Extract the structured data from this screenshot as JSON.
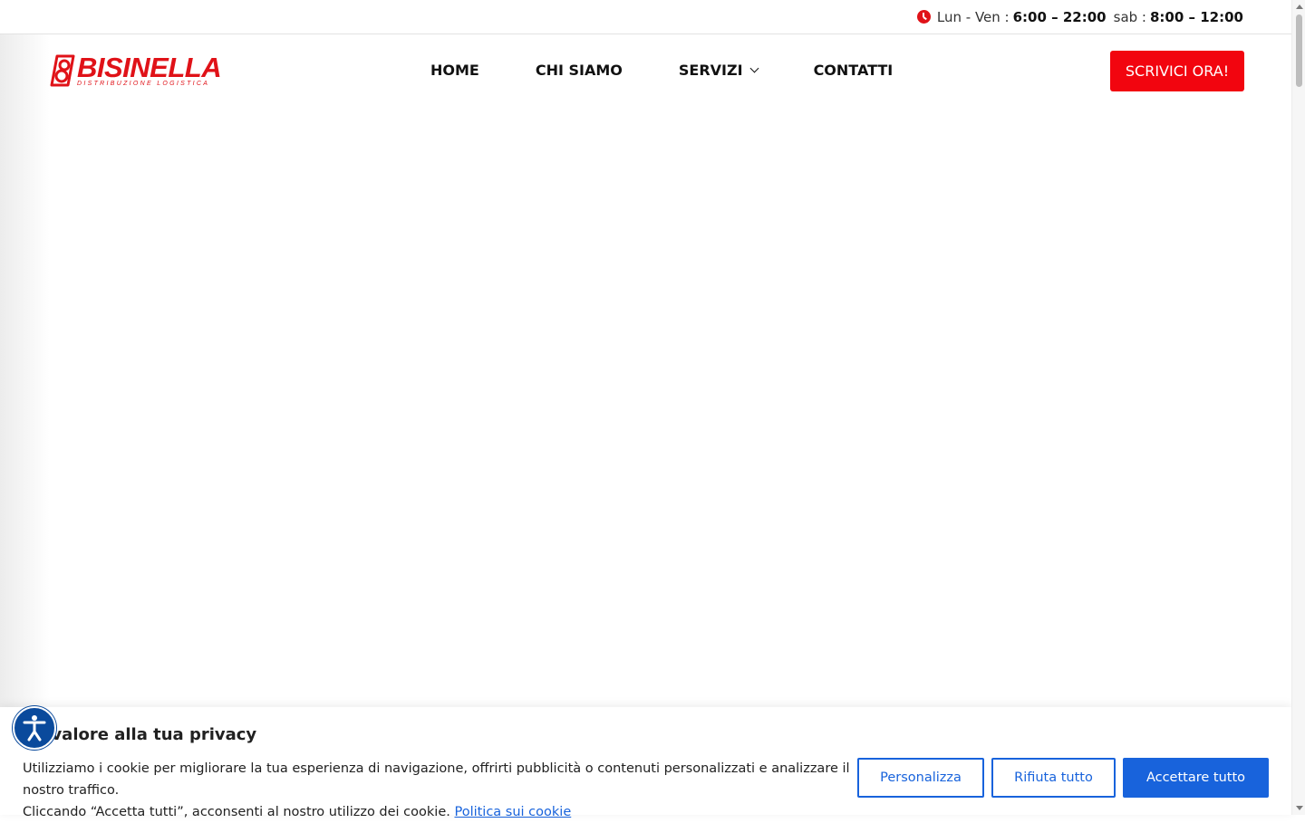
{
  "topbar": {
    "weekday_label": "Lun - Ven :",
    "weekday_hours": "6:00 – 22:00",
    "saturday_label": "sab :",
    "saturday_hours": "8:00 – 12:00"
  },
  "logo": {
    "name": "BISINELLA",
    "tagline": "DISTRIBUZIONE LOGISTICA"
  },
  "nav": {
    "items": [
      {
        "label": "HOME"
      },
      {
        "label": "CHI SIAMO"
      },
      {
        "label": "SERVIZI"
      },
      {
        "label": "CONTATTI"
      }
    ]
  },
  "cta": {
    "label": "SCRIVICI ORA!"
  },
  "cookie": {
    "title": "no valore alla tua privacy",
    "text_line1": "Utilizziamo i cookie per migliorare la tua esperienza di navigazione, offrirti pubblicità o contenuti personalizzati e analizzare il nostro traffico.",
    "text_line2": "Cliccando “Accetta tutti”, acconsenti al nostro utilizzo dei cookie.",
    "link": "Politica sui cookie",
    "customize": "Personalizza",
    "reject": "Rifiuta tutto",
    "accept": "Accettare tutto"
  },
  "colors": {
    "brand_red": "#e01218",
    "cta_red": "#f2050f",
    "cookie_blue": "#1863dc",
    "a11y_blue": "#0a4a9c"
  },
  "icons": {
    "clock": "clock-icon",
    "chevron": "chevron-down-icon",
    "accessibility": "accessibility-icon"
  }
}
